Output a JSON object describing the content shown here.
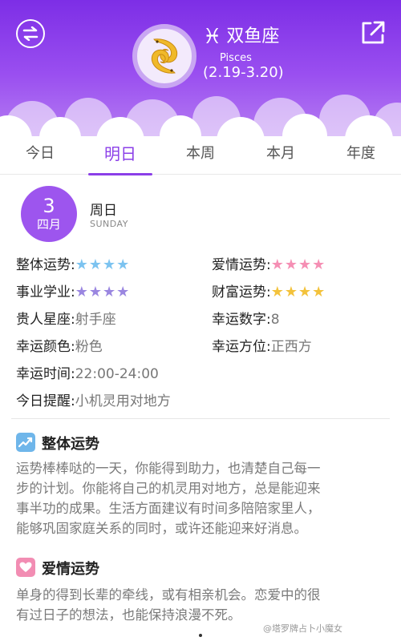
{
  "header": {
    "sign_glyph": "♓",
    "sign_name": "双鱼座",
    "sign_en": "Pisces",
    "sign_date": "(2.19-3.20)",
    "swap_icon": "swap-arrows-icon",
    "share_icon": "share-external-icon",
    "colors": {
      "gradient_top": "#7d2ee6",
      "gradient_bottom": "#b57cf2",
      "emblem_fish": "#f0b92a"
    }
  },
  "tabs": [
    {
      "label": "今日",
      "active": false
    },
    {
      "label": "明日",
      "active": true
    },
    {
      "label": "本周",
      "active": false
    },
    {
      "label": "本月",
      "active": false
    },
    {
      "label": "年度",
      "active": false
    }
  ],
  "date": {
    "day": "3",
    "month": "四月",
    "weekday": "周日",
    "weekday_en": "SUNDAY"
  },
  "fortune": {
    "overall": {
      "label": "整体运势:",
      "stars": "★★★★",
      "rating": 4,
      "color": "#7cc3f0"
    },
    "love": {
      "label": "爱情运势:",
      "stars": "★★★★",
      "rating": 4,
      "color": "#f58fb4"
    },
    "career": {
      "label": "事业学业:",
      "stars": "★★★★",
      "rating": 4,
      "color": "#9a86e0"
    },
    "wealth": {
      "label": "财富运势:",
      "stars": "★★★★",
      "rating": 4,
      "color": "#f3c23b"
    },
    "noble": {
      "label": "贵人星座:",
      "value": "射手座"
    },
    "lucky_number": {
      "label": "幸运数字:",
      "value": "8"
    },
    "lucky_color": {
      "label": "幸运颜色:",
      "value": "粉色"
    },
    "lucky_direction": {
      "label": "幸运方位:",
      "value": "正西方"
    },
    "lucky_time": {
      "label": "幸运时间:",
      "value": "22:00-24:00"
    },
    "reminder": {
      "label": "今日提醒:",
      "value": "小机灵用对地方"
    }
  },
  "sections": {
    "overall": {
      "title": "整体运势",
      "icon": "trend-chart-icon",
      "lines": [
        "运势棒棒哒的一天，你能得到助力，也清楚自己每一",
        "步的计划。你能将自己的机灵用对地方，总是能迎来",
        "事半功的成果。生活方面建议有时间多陪陪家里人，",
        "能够巩固家庭关系的同时，或许还能迎来好消息。"
      ]
    },
    "love": {
      "title": "爱情运势",
      "icon": "heart-icon",
      "lines": [
        "单身的得到长辈的牵线，或有相亲机会。恋爱中的很",
        "有过日子的想法，也能保持浪漫不死。"
      ]
    }
  },
  "watermark": "@塔罗牌占卜小魔女"
}
